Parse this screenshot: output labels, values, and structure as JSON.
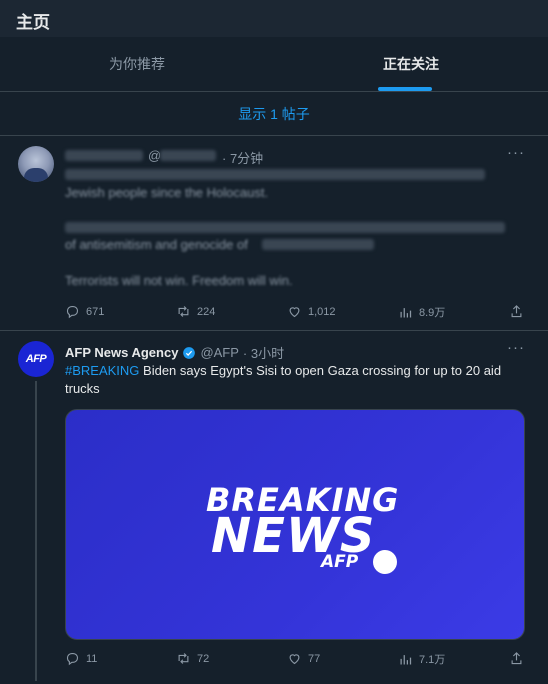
{
  "header": {
    "title": "主页"
  },
  "tabs": [
    {
      "label": "为你推荐",
      "active": false
    },
    {
      "label": "正在关注",
      "active": true
    }
  ],
  "show_posts": "显示 1 帖子",
  "tweet1": {
    "handle_partial": "@",
    "time": "7分钟",
    "text_line1": "Jewish people since the Holocaust.",
    "text_line3": "of antisemitism and genocide of",
    "text_line4": "Terrorists will not win. Freedom will win.",
    "stats": {
      "replies": "671",
      "retweets": "224",
      "likes": "1,012",
      "views": "8.9万"
    }
  },
  "tweet2": {
    "name": "AFP News Agency",
    "handle": "@AFP",
    "time": "3小时",
    "hashtag": "#BREAKING",
    "text": " Biden says Egypt's Sisi to open Gaza crossing for up to 20 aid trucks",
    "avatar_text": "AFP",
    "card": {
      "line1": "BREAKING",
      "line2": "NEWS",
      "brand": "AFP"
    },
    "stats": {
      "replies": "11",
      "retweets": "72",
      "likes": "77",
      "views": "7.1万"
    }
  },
  "more_glyph": "···",
  "colors": {
    "accent": "#1d9bf0",
    "background": "#15202b",
    "border": "#38444d",
    "card": "#2f2fd4"
  }
}
